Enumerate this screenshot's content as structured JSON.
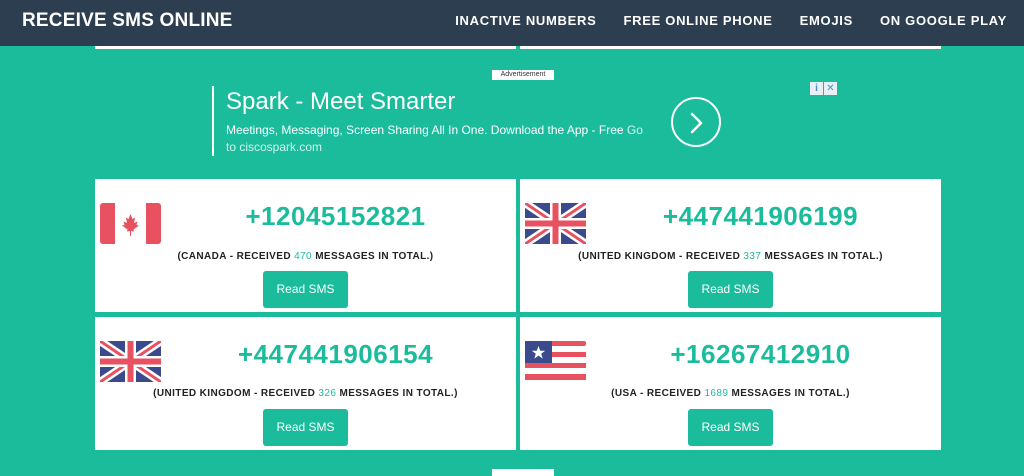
{
  "header": {
    "brand": "RECEIVE SMS ONLINE",
    "nav": [
      "INACTIVE NUMBERS",
      "FREE ONLINE PHONE",
      "EMOJIS",
      "ON GOOGLE PLAY"
    ]
  },
  "ad": {
    "label": "Advertisement",
    "title": "Spark - Meet Smarter",
    "description": "Meetings, Messaging, Screen Sharing All In One. Download the App - Free",
    "link_text": "Go to ciscospark.com",
    "choices_icon": "info-icon",
    "close_icon": "close-icon",
    "arrow_icon": "chevron-right-icon"
  },
  "numbers": [
    {
      "phone": "+12045152821",
      "prefix": "(CANADA - RECEIVED ",
      "count": "470",
      "suffix": " MESSAGES IN TOTAL.)",
      "button": "Read SMS",
      "flag": "canada-flag-icon"
    },
    {
      "phone": "+447441906199",
      "prefix": "(UNITED KINGDOM - RECEIVED ",
      "count": "337",
      "suffix": " MESSAGES IN TOTAL.)",
      "button": "Read SMS",
      "flag": "uk-flag-icon"
    },
    {
      "phone": "+447441906154",
      "prefix": "(UNITED KINGDOM - RECEIVED ",
      "count": "326",
      "suffix": " MESSAGES IN TOTAL.)",
      "button": "Read SMS",
      "flag": "uk-flag-icon"
    },
    {
      "phone": "+16267412910",
      "prefix": "(USA - RECEIVED ",
      "count": "1689",
      "suffix": " MESSAGES IN TOTAL.)",
      "button": "Read SMS",
      "flag": "usa-flag-icon"
    }
  ],
  "colors": {
    "accent": "#1abc9c",
    "navbar": "#2c3e50",
    "card": "#ffffff"
  }
}
